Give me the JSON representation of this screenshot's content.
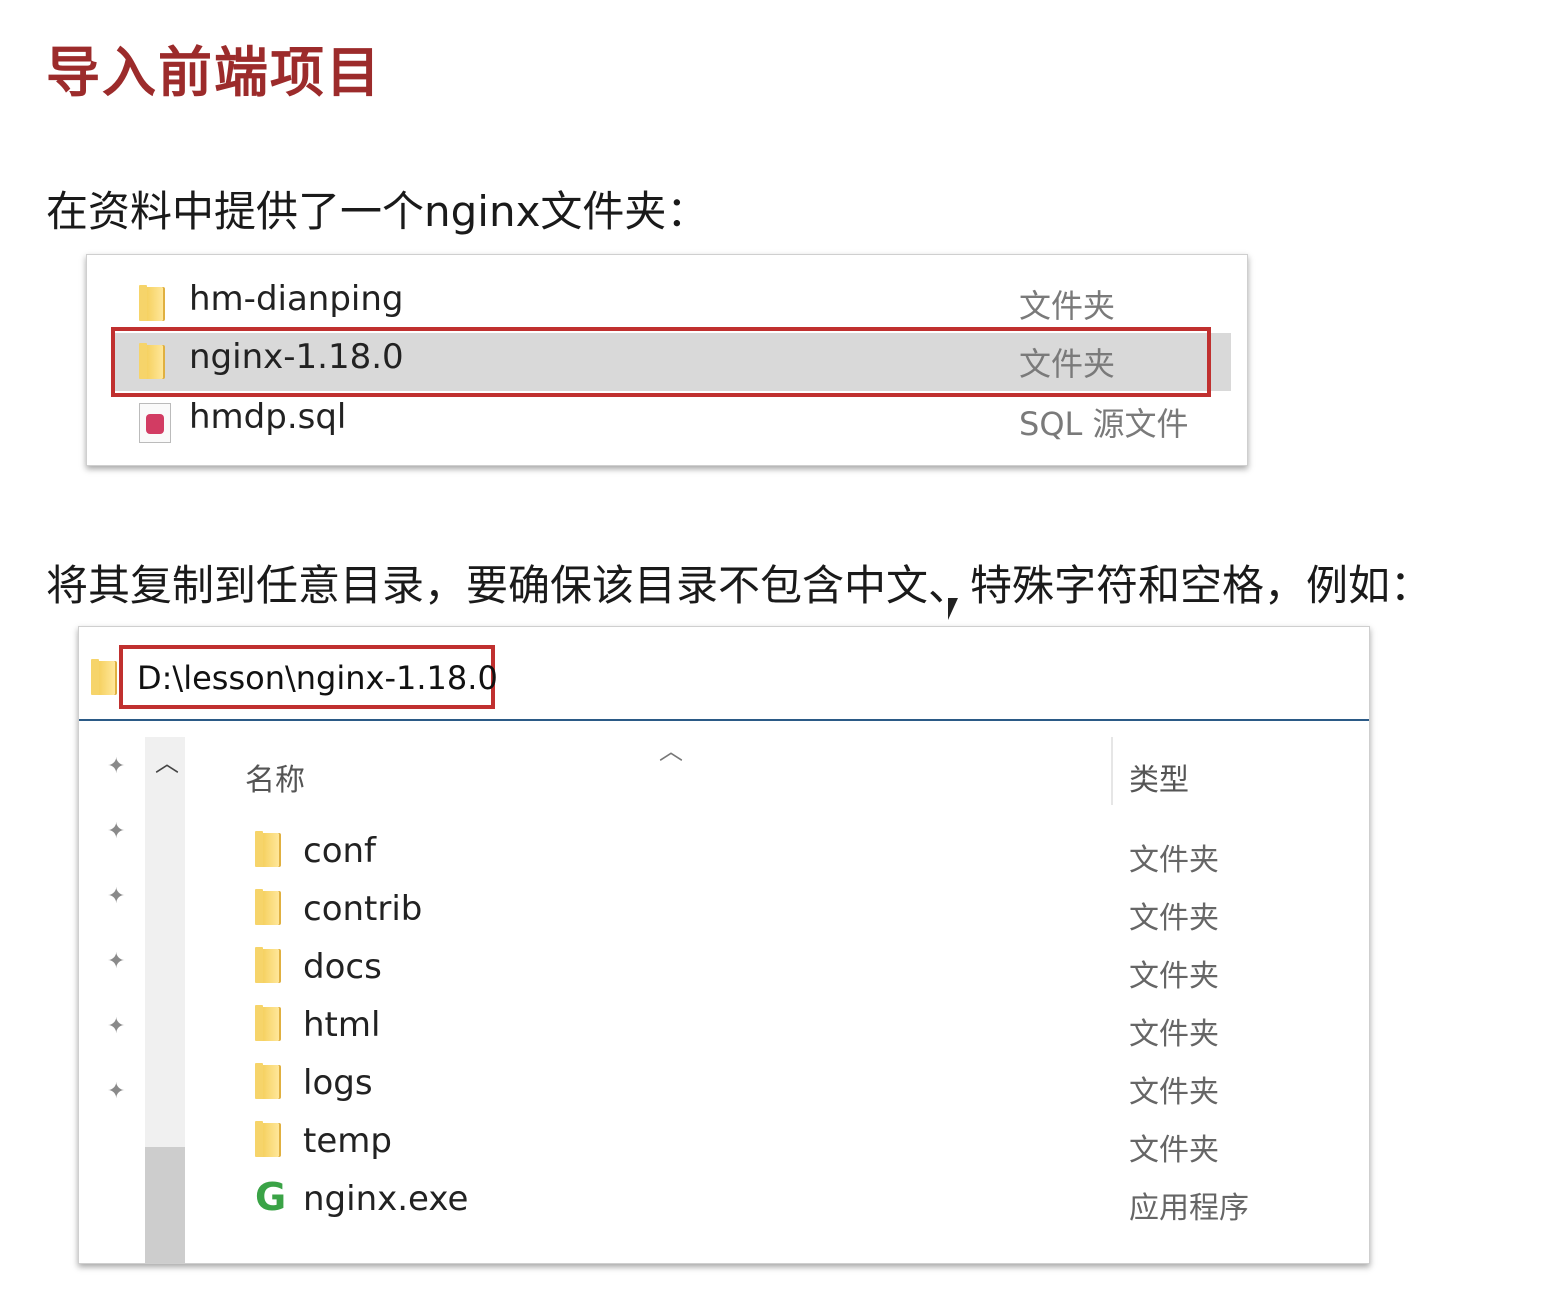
{
  "title": "导入前端项目",
  "para1": "在资料中提供了一个nginx文件夹：",
  "para2": "将其复制到任意目录，要确保该目录不包含中文、特殊字符和空格，例如：",
  "listing1": [
    {
      "name": "hm-dianping",
      "type": "文件夹",
      "icon": "folder-icon",
      "selected": false
    },
    {
      "name": "nginx-1.18.0",
      "type": "文件夹",
      "icon": "folder-icon",
      "selected": true
    },
    {
      "name": "hmdp.sql",
      "type": "SQL 源文件",
      "icon": "sql-file-icon",
      "selected": false
    }
  ],
  "explorer": {
    "address": "D:\\lesson\\nginx-1.18.0",
    "col_name": "名称",
    "col_type": "类型",
    "items": [
      {
        "name": "conf",
        "type": "文件夹",
        "icon": "folder-icon"
      },
      {
        "name": "contrib",
        "type": "文件夹",
        "icon": "folder-icon"
      },
      {
        "name": "docs",
        "type": "文件夹",
        "icon": "folder-icon"
      },
      {
        "name": "html",
        "type": "文件夹",
        "icon": "folder-icon"
      },
      {
        "name": "logs",
        "type": "文件夹",
        "icon": "folder-icon"
      },
      {
        "name": "temp",
        "type": "文件夹",
        "icon": "folder-icon"
      },
      {
        "name": "nginx.exe",
        "type": "应用程序",
        "icon": "nginx-exe-icon"
      }
    ]
  },
  "colors": {
    "title": "#9c2b2b",
    "highlight_box": "#c0302f",
    "address_border": "#2b5a86",
    "selected_row": "#d9d9d9"
  }
}
